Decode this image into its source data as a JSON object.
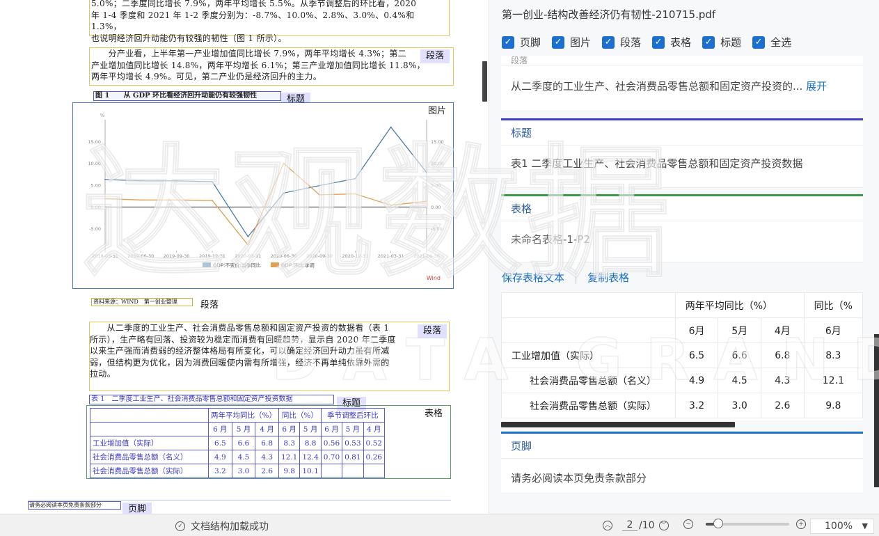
{
  "doc": {
    "intro_lines": [
      "5.0%；二季度同比增长 7.9%，两年平均增长 5.5%。从季节调整后的环比看，2020",
      "年 1-4 季度和 2021 年 1-2 季度分别为：-8.7%、10.0%、2.8%、3.0%、0.4%和 1.3%，",
      "也说明经济回升动能仍有较强的韧性（图 1 所示）。"
    ],
    "industry_lines": [
      "　　分产业看，上半年第一产业增加值同比增长 7.9%，两年平均增长 4.3%；第二",
      "产业增加值同比增长 14.8%，两年平均增长 6.1%；第三产业增加值同比增长 11.8%，",
      "两年平均增长 4.9%。可见，第二产业仍是经济回升的主力。"
    ],
    "tag_industry": "段落",
    "figure_title": "图 1　　从 GDP 环比看经济回升动能仍有较强韧性",
    "tag_title": "标题",
    "tag_figure": "图片",
    "source": "资料来源：WIND　第一创业整理",
    "tag_para": "段落",
    "demand_lines": [
      "　　从二季度的工业生产、社会消费品零售总额和固定资产投资的数据看（表 1",
      "所示），生产略有回落、投资较为稳定而消费有回暖趋势，显示自 2020 年二季度",
      "以来生产强而消费弱的经济整体格局有所变化，可以确定经济回升动力虽有所减",
      "弱，但结构更为优化，因为消费回暖使内需有所增强，经济不再单纯依靠外需的",
      "拉动。"
    ],
    "tag_demand": "段落",
    "table_title": "表 1　二季度工业生产、社会消费品零售总额和固定资产投资数据",
    "tag_table_title": "标题",
    "tag_table": "表格",
    "table": {
      "group_headers": [
        "两年平均同比（%）",
        "同比（%）",
        "季节调整后环比"
      ],
      "months": [
        "6 月",
        "5 月",
        "4 月",
        "6 月",
        "5 月",
        "6 月",
        "5 月",
        "4 月"
      ],
      "rows": [
        {
          "label": "工业增加值（实际）",
          "values": [
            "6.5",
            "6.6",
            "6.8",
            "8.3",
            "8.8",
            "0.56",
            "0.53",
            "0.52"
          ]
        },
        {
          "label": "社会消费品零售总额（名义）",
          "values": [
            "4.9",
            "4.5",
            "4.3",
            "12.1",
            "12.4",
            "0.70",
            "0.81",
            "0.26"
          ]
        },
        {
          "label": "社会消费品零售总额（实际）",
          "values": [
            "3.2",
            "3.0",
            "2.6",
            "9.8",
            "10.1",
            "",
            "",
            ""
          ]
        }
      ]
    },
    "footer_text": "请务必阅读本页免责条款部分",
    "tag_footer": "页脚"
  },
  "chart_data": {
    "type": "line",
    "x": [
      "2019-03-31",
      "2019-06-30",
      "2019-09-30",
      "2019-12-31",
      "2020-03-31",
      "2020-06-30",
      "2020-09-30",
      "2020-12-31",
      "2021-03-31",
      "2021-06-30"
    ],
    "series": [
      {
        "name": "GDP:不变价:当季同比",
        "axis": "left",
        "color": "#4a7aa8",
        "values": [
          6.3,
          6.0,
          6.0,
          5.8,
          -6.8,
          3.2,
          4.9,
          6.5,
          18.3,
          7.9
        ]
      },
      {
        "name": "GDP:环比:季调",
        "axis": "right",
        "color": "#e0a050",
        "values": [
          1.9,
          1.6,
          1.6,
          1.5,
          -8.7,
          10.0,
          2.8,
          3.0,
          0.4,
          1.3
        ]
      }
    ],
    "ylim": [
      -10,
      20
    ],
    "left_unit": "%",
    "right_unit": "%",
    "y_ticks": [
      "15.00",
      "10.00",
      "5.00",
      "0.00",
      "-5.00"
    ],
    "y_tick_values": [
      15,
      10,
      5,
      0,
      -5
    ],
    "legend": "bottom",
    "brand": "Wind",
    "grid": false
  },
  "panel": {
    "file_title": "第一创业-结构改善经济仍有韧性-210715.pdf",
    "filters": [
      "页脚",
      "图片",
      "段落",
      "表格",
      "标题",
      "全选"
    ],
    "para_card": {
      "head": "段落",
      "text": "从二季度的工业生产、社会消费品零售总额和固定资产投资的...",
      "more": "展开"
    },
    "title_card": {
      "head": "标题",
      "text": "表1 二季度工业生产、社会消费品零售总额和固定资产投资数据"
    },
    "table_card": {
      "head": "表格",
      "text": "未命名表格-1-P2"
    },
    "save_table": "保存表格文本",
    "copy_table": "复制表格",
    "table": {
      "group_headers": [
        "两年平均同比（%）",
        "同比（%"
      ],
      "months": [
        "6月",
        "5月",
        "4月",
        "6月"
      ],
      "rows": [
        {
          "label": "工业增加值（实际）",
          "values": [
            "6.5",
            "6.6",
            "6.8",
            "8.3"
          ]
        },
        {
          "label": "社会消费品零售总额（名义）",
          "values": [
            "4.9",
            "4.5",
            "4.3",
            "12.1"
          ]
        },
        {
          "label": "社会消费品零售总额（实际）",
          "values": [
            "3.2",
            "3.0",
            "2.6",
            "9.8"
          ]
        }
      ]
    },
    "footer_card": {
      "head": "页脚",
      "text": "请务必阅读本页免责条款部分"
    }
  },
  "watermark": {
    "cn": "达观数据",
    "en": "DATA GRAND"
  },
  "status": {
    "message": "文档结构加载成功",
    "page": "2",
    "total": "/10",
    "zoom_label": "100%",
    "zoom_fraction": 0.15
  },
  "colors": {
    "accent": "#1a6fd1",
    "title_border": "#3a3acb",
    "table_border": "#3a9a4a"
  }
}
